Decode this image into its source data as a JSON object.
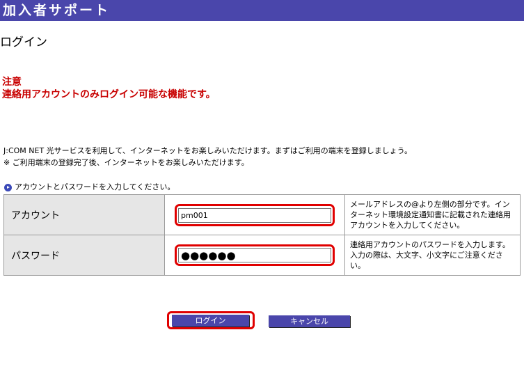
{
  "header": {
    "title": "加入者サポート",
    "bg_color": "#4a46ab"
  },
  "page_title": "ログイン",
  "notice": {
    "heading": "注意",
    "message": "連絡用アカウントのみログイン可能な機能です。",
    "color": "#c80000"
  },
  "intro": {
    "line1": "J:COM NET 光サービスを利用して、インターネットをお楽しみいただけます。まずはご利用の端末を登録しましょう。",
    "line2": "※ ご利用端末の登録完了後、インターネットをお楽しみいただけます。"
  },
  "instruction": "アカウントとパスワードを入力してください。",
  "form": {
    "account": {
      "label": "アカウント",
      "value": "pm001",
      "help": "メールアドレスの@より左側の部分です。インターネット環境設定通知書に記載された連絡用アカウントを入力してください。"
    },
    "password": {
      "label": "パスワード",
      "value": "●●●●●●",
      "help": "連絡用アカウントのパスワードを入力します。入力の際は、大文字、小文字にご注意ください。"
    }
  },
  "buttons": {
    "login": "ログイン",
    "cancel": "キャンセル"
  },
  "highlight_color": "#e00000"
}
